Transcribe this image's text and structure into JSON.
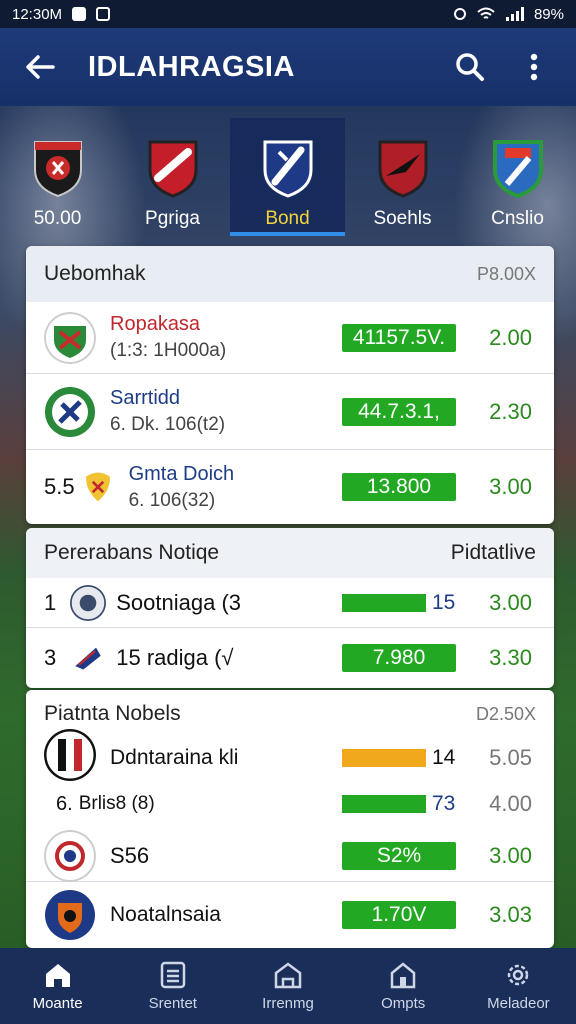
{
  "status": {
    "time": "12:30M",
    "battery": "89%"
  },
  "app": {
    "title": "IDLAHRAGSIA"
  },
  "tabs": [
    {
      "label": "50.00",
      "active": false
    },
    {
      "label": "Pgriga",
      "active": false
    },
    {
      "label": "Bond",
      "active": true
    },
    {
      "label": "Soehls",
      "active": false
    },
    {
      "label": "Cnslio",
      "active": false
    }
  ],
  "section1": {
    "title": "Uebomhak",
    "right": "P8.00X",
    "rows": [
      {
        "name": "Ropakasa",
        "sub": "(1:3: 1H000a)",
        "odds": "41157.5V.",
        "value": "2.00",
        "name_color": "#c0282d"
      },
      {
        "name": "Sarrtidd",
        "sub": "6. Dk. 106(t2)",
        "odds": "44.7.3.1,",
        "value": "2.30",
        "name_color": "#1e3c86"
      },
      {
        "prefix": "5.5",
        "name": "Gmta Doich",
        "sub": "6. 106(32)",
        "odds": "13.800",
        "value": "3.00",
        "name_color": "#1e3c86"
      }
    ]
  },
  "section2": {
    "title": "Pererabans Notiqe",
    "right": "Pidtatlive",
    "rows": [
      {
        "prefix": "1",
        "name": "Sootniaga (3",
        "badge": "15",
        "value": "3.00"
      },
      {
        "prefix": "3",
        "name": "15 radiga (√",
        "odds": "7.980",
        "value": "3.30"
      }
    ]
  },
  "section3": {
    "title": "Piatnta Nobels",
    "right": "D2.50X",
    "rows": [
      {
        "name": "Ddntaraina kli",
        "badge": "14",
        "value": "5.05"
      },
      {
        "prefix": "6.",
        "name": "Brlis8 (8)",
        "badge": "73",
        "value": "4.00"
      },
      {
        "name": "S56",
        "odds": "S2%",
        "value": "3.00"
      },
      {
        "name": "Noatalnsaia",
        "odds": "1.70V",
        "value": "3.03"
      }
    ]
  },
  "nav": [
    {
      "label": "Moante",
      "icon": "home-icon",
      "active": true
    },
    {
      "label": "Srentet",
      "icon": "list-icon",
      "active": false
    },
    {
      "label": "Irrenmg",
      "icon": "building-icon",
      "active": false
    },
    {
      "label": "Ompts",
      "icon": "house-icon",
      "active": false
    },
    {
      "label": "Meladeor",
      "icon": "settings-icon",
      "active": false
    }
  ],
  "colors": {
    "accent": "#2f8fe8",
    "odds_green": "#22a822",
    "appbar": "#1e3a78"
  }
}
